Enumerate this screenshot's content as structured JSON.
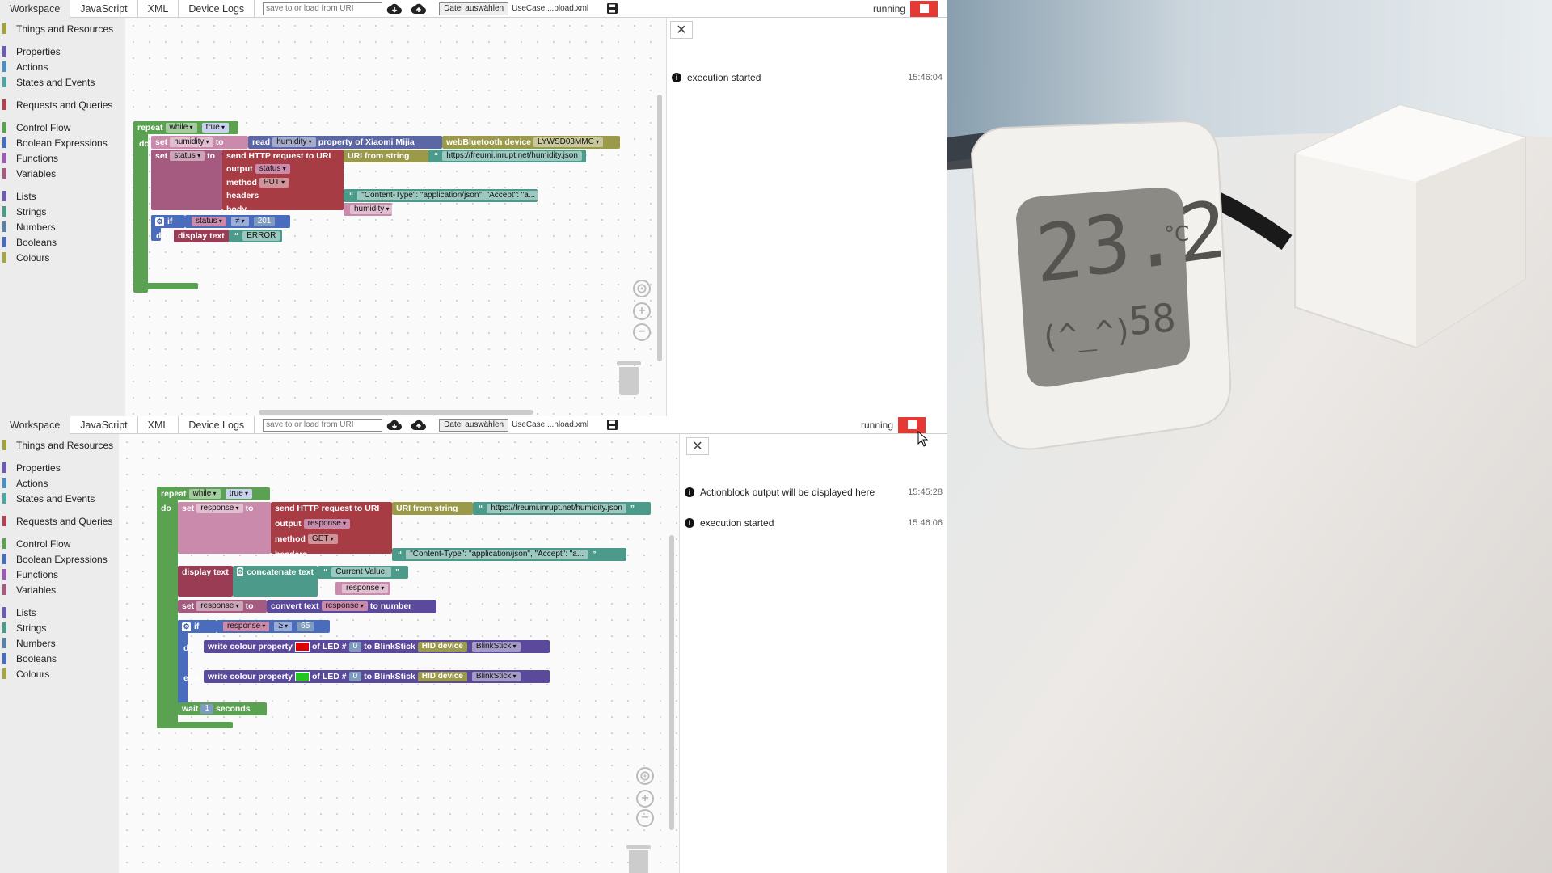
{
  "tabs": [
    "Workspace",
    "JavaScript",
    "XML",
    "Device Logs"
  ],
  "uri_placeholder": "save to or load from URI",
  "file_button": "Datei auswählen",
  "status": "running",
  "categories": {
    "things": "Things and Resources",
    "properties": "Properties",
    "actions": "Actions",
    "states": "States and Events",
    "requests": "Requests and Queries",
    "control": "Control Flow",
    "boolean": "Boolean Expressions",
    "functions": "Functions",
    "variables": "Variables",
    "lists": "Lists",
    "strings": "Strings",
    "numbers": "Numbers",
    "booleans": "Booleans",
    "colours": "Colours"
  },
  "colors": {
    "stop": "#e53935",
    "control": "#5aa251",
    "http": "#a73c45",
    "led": "#5b4a9b"
  },
  "panel_a": {
    "file_name": "UseCase....pload.xml",
    "log": [
      {
        "text": "execution started",
        "time": "15:46:04"
      }
    ],
    "blocks": {
      "repeat": "repeat",
      "while": "while",
      "true": "true",
      "do": "do",
      "set": "set",
      "var_humidity": "humidity",
      "to": "to",
      "read": "read",
      "prop_humidity": "humidity",
      "property_of": "property of Xiaomi Mijia",
      "webbt": "webBluetooth device",
      "device_id": "LYWSD03MMC",
      "var_status": "status",
      "send_http": "send HTTP request to URI",
      "uri_from_string": "URI from string",
      "url": "https://freumi.inrupt.net/humidity.json",
      "output": "output",
      "output_var": "status",
      "method": "method",
      "method_val": "PUT",
      "headers": "headers",
      "headers_val": "\"Content-Type\": \"application/json\", \"Accept\": \"a...",
      "body": "body",
      "body_val": "humidity",
      "if": "if",
      "cmp_var": "status",
      "op": "≠",
      "num": "201",
      "display_text": "display text",
      "error": "ERROR"
    }
  },
  "panel_b": {
    "file_name": "UseCase....nload.xml",
    "log": [
      {
        "text": "Actionblock output will be displayed here",
        "time": "15:45:28"
      },
      {
        "text": "execution started",
        "time": "15:46:06"
      }
    ],
    "blocks": {
      "repeat": "repeat",
      "while": "while",
      "true": "true",
      "do": "do",
      "set": "set",
      "var_response": "response",
      "to": "to",
      "send_http": "send HTTP request to URI",
      "uri_from_string": "URI from string",
      "url": "https://freumi.inrupt.net/humidity.json",
      "output": "output",
      "output_var": "response",
      "method": "method",
      "method_val": "GET",
      "headers": "headers",
      "headers_val": "\"Content-Type\": \"application/json\", \"Accept\": \"a...",
      "display_text": "display text",
      "concat": "concatenate text",
      "current_value": "Current Value: ",
      "concat_var": "response",
      "convert_text": "convert text",
      "convert_var": "response",
      "to_number": "to number",
      "if": "if",
      "cmp_var": "response",
      "op": "≥",
      "num": "65",
      "else": "else",
      "write_colour": "write colour property",
      "of_led": "of LED #",
      "led_num": "0",
      "to_blinkstick": "to BlinkStick",
      "hid_device": "HID device",
      "blinkstick": "BlinkStick",
      "wait": "wait",
      "wait_num": "1",
      "seconds": "seconds"
    }
  },
  "photo": {
    "temperature": "23.2",
    "unit": "°C",
    "humidity": "58",
    "face": "(^_^)"
  }
}
